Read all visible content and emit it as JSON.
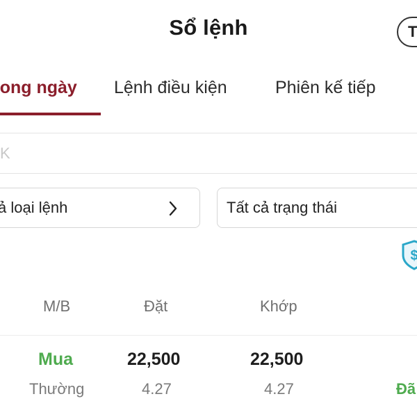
{
  "header": {
    "title": "Sổ lệnh",
    "pill_label": "T"
  },
  "tabs": [
    {
      "label": "rong ngày",
      "active": true
    },
    {
      "label": "Lệnh điều kiện",
      "active": false
    },
    {
      "label": "Phiên kế tiếp",
      "active": false
    }
  ],
  "search": {
    "value": "K"
  },
  "filters": {
    "order_type": "ả loại lệnh",
    "status": "Tất cả trạng thái"
  },
  "icons": {
    "shield": "shield-dollar-icon",
    "chevron": "chevron-right-icon"
  },
  "table": {
    "headers": {
      "side": "M/B",
      "order": "Đặt",
      "matched": "Khớp"
    },
    "rows": [
      {
        "side": "Mua",
        "order_type": "Thường",
        "order_price": "22,500",
        "order_qty": "4.27",
        "match_price": "22,500",
        "match_qty": "4.27",
        "status": "Đã"
      }
    ]
  },
  "colors": {
    "accent": "#8b1e2b",
    "buy": "#4fab4f",
    "shield": "#2aa7c9"
  }
}
